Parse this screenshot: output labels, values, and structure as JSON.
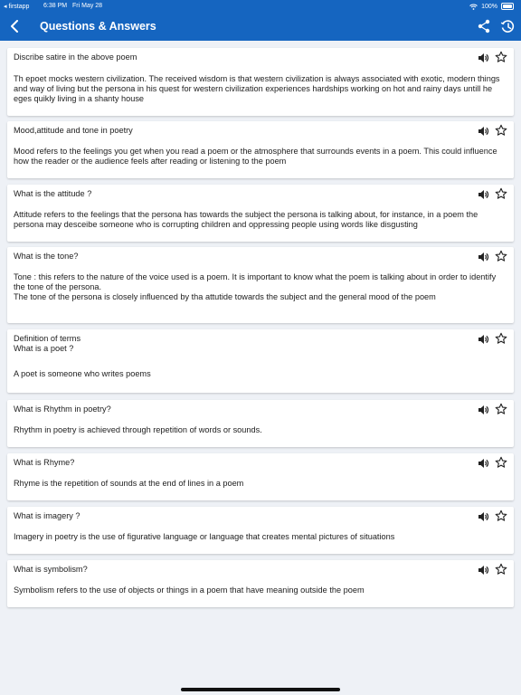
{
  "status_bar": {
    "carrier": "◂ firstapp",
    "time": "6:38 PM",
    "date": "Fri May 28",
    "battery": "100%"
  },
  "app_bar": {
    "title": "Questions & Answers",
    "back_icon": "chevron-left-icon",
    "share_icon": "share-icon",
    "history_icon": "history-icon"
  },
  "colors": {
    "primary": "#1565c0",
    "background": "#eef1f6",
    "card": "#ffffff",
    "text": "#212121"
  },
  "items": [
    {
      "question": "Discribe satire in the above poem",
      "answer": "Th epoet mocks western civilization. The received wisdom is that western civilization is always associated with exotic, modern things and way of living but the persona in his quest for western civilization experiences hardships working on hot and rainy days untill he eges quikly living in a shanty house"
    },
    {
      "question": "Mood,attitude and tone in poetry",
      "answer": "Mood refers to the feelings you get when you read a poem or the atmosphere that surrounds events in a poem. This could influence how the reader or the audience feels after reading or listening to the poem"
    },
    {
      "question": "What is the attitude ?",
      "answer": "Attitude refers to the feelings that the persona has towards the subject the persona is talking about, for instance, in a poem the persona may desceibe someone who is corrupting children and oppressing people using words like disgusting"
    },
    {
      "question": "What is the tone?",
      "answer": "Tone : this refers to the nature of the voice used is a poem. It is important to know what the poem is talking about in order to identify the tone of the persona.\nThe tone of the persona is closely influenced by tha attutide towards the subject and the general mood of the poem"
    },
    {
      "question": "Definition of terms\nWhat is a poet ?",
      "answer": "A poet   is someone who writes poems"
    },
    {
      "question": "What is Rhythm in poetry?",
      "answer": "Rhythm in poetry is achieved through repetition of words or sounds."
    },
    {
      "question": "What is Rhyme?",
      "answer": "Rhyme is the repetition of sounds at the end of lines in   a poem"
    },
    {
      "question": "What is imagery ?",
      "answer": "Imagery in poetry is the use of figurative language or language that creates mental pictures of situations"
    },
    {
      "question": "What is symbolism?",
      "answer": "Symbolism  refers to the use of objects or things in a poem that have meaning outside the poem"
    }
  ]
}
